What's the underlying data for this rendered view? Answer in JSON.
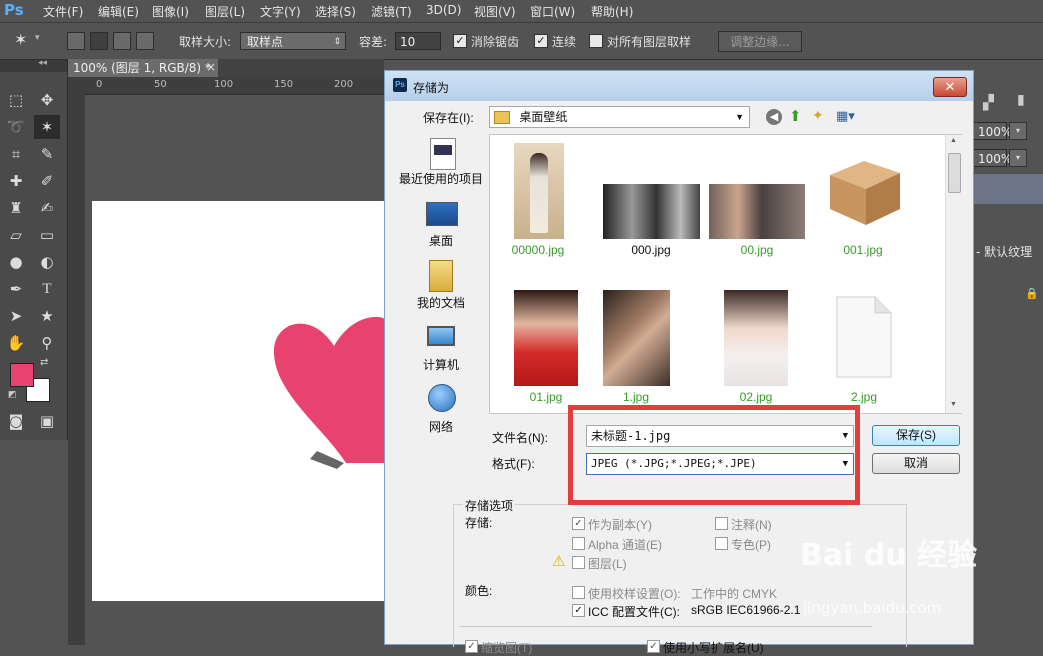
{
  "app": {
    "logo": "Ps"
  },
  "menu": [
    "文件(F)",
    "编辑(E)",
    "图像(I)",
    "图层(L)",
    "文字(Y)",
    "选择(S)",
    "滤镜(T)",
    "3D(D)",
    "视图(V)",
    "窗口(W)",
    "帮助(H)"
  ],
  "options": {
    "sample_size_label": "取样大小:",
    "sample_size_value": "取样点",
    "tolerance_label": "容差:",
    "tolerance_value": "10",
    "antialias_label": "消除锯齿",
    "contiguous_label": "连续",
    "all_layers_label": "对所有图层取样",
    "refine_edge_label": "调整边缘..."
  },
  "document": {
    "tab_title": "100% (图层 1, RGB/8) *",
    "tab_close": "×",
    "ruler_ticks": [
      "0",
      "50",
      "100",
      "150",
      "200"
    ]
  },
  "colors": {
    "foreground": "#e8436e",
    "background": "#ffffff",
    "heart": "#e8436e",
    "accent_red": "#e43d3d",
    "file_name_green": "#3a9a2a"
  },
  "right_panel": {
    "opacity_value": "100%",
    "fill_value": "100%",
    "layer_style_label": "- 默认纹理"
  },
  "dialog": {
    "title": "存储为",
    "close": "✕",
    "save_in_label": "保存在(I):",
    "save_in_value": "桌面壁纸",
    "places": [
      {
        "label": "最近使用的项目",
        "icon": "recent-items-icon"
      },
      {
        "label": "桌面",
        "icon": "desktop-icon"
      },
      {
        "label": "我的文档",
        "icon": "my-documents-icon"
      },
      {
        "label": "计算机",
        "icon": "computer-icon"
      },
      {
        "label": "网络",
        "icon": "network-icon"
      }
    ],
    "files": [
      {
        "name": "00000.jpg",
        "thumb": "qipao-photo"
      },
      {
        "name": "000.jpg",
        "thumb": "street-photo"
      },
      {
        "name": "00.jpg",
        "thumb": "sitting-woman-photo"
      },
      {
        "name": "001.jpg",
        "thumb": "cardboard-box-icon"
      },
      {
        "name": "01.jpg",
        "thumb": "red-dress-portrait"
      },
      {
        "name": "1.jpg",
        "thumb": "portrait-photo"
      },
      {
        "name": "02.jpg",
        "thumb": "white-portrait"
      },
      {
        "name": "2.jpg",
        "thumb": "blank-file-icon"
      }
    ],
    "filename_label": "文件名(N):",
    "filename_value": "未标题-1.jpg",
    "format_label": "格式(F):",
    "format_value": "JPEG (*.JPG;*.JPEG;*.JPE)",
    "save_button": "保存(S)",
    "cancel_button": "取消",
    "save_options_title": "存储选项",
    "save_label": "存储:",
    "as_copy_label": "作为副本(Y)",
    "notes_label": "注释(N)",
    "alpha_label": "Alpha 通道(E)",
    "spot_label": "专色(P)",
    "layers_label": "图层(L)",
    "color_label": "颜色:",
    "proof_label": "使用校样设置(O):",
    "proof_value": "工作中的 CMYK",
    "icc_label": "ICC 配置文件(C):",
    "icc_value": "sRGB IEC61966-2.1",
    "thumbnail_label": "缩览图(T)",
    "lowercase_ext_label": "使用小写扩展名(U)"
  },
  "watermark": {
    "main": "Bai du 经验",
    "sub": "jingyan.baidu.com"
  }
}
